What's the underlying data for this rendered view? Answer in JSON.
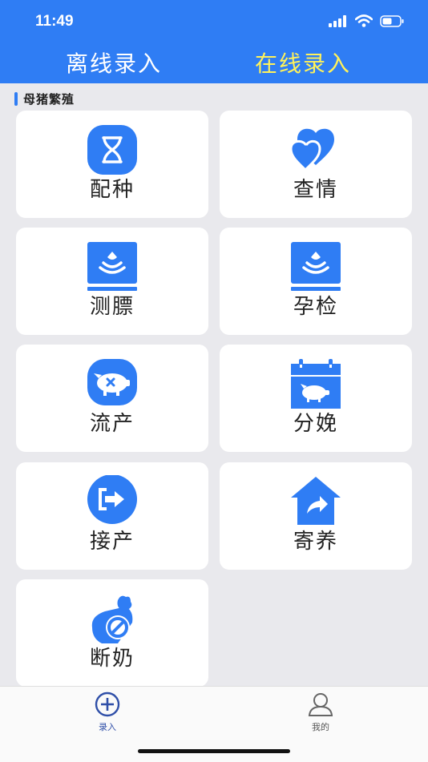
{
  "status_bar": {
    "time": "11:49"
  },
  "tabs": {
    "offline": "离线录入",
    "online": "在线录入"
  },
  "section": {
    "title": "母猪繁殖"
  },
  "cards": [
    {
      "label": "配种",
      "icon": "dna-icon"
    },
    {
      "label": "查情",
      "icon": "hearts-icon"
    },
    {
      "label": "测膘",
      "icon": "ultrasound-icon"
    },
    {
      "label": "孕检",
      "icon": "ultrasound-icon"
    },
    {
      "label": "流产",
      "icon": "pig-cross-icon"
    },
    {
      "label": "分娩",
      "icon": "calendar-pig-icon"
    },
    {
      "label": "接产",
      "icon": "exit-door-icon"
    },
    {
      "label": "寄养",
      "icon": "house-share-icon"
    },
    {
      "label": "断奶",
      "icon": "bottle-ban-icon"
    }
  ],
  "bottom_tabs": {
    "record": "录入",
    "mine": "我的"
  },
  "colors": {
    "accent": "#2f7df4",
    "online_tab": "#fff25a",
    "background": "#e9e9ed"
  }
}
